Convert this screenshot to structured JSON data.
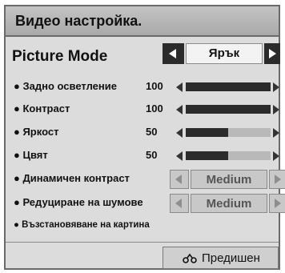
{
  "title": "Видео настройка.",
  "picture_mode": {
    "label": "Picture Mode",
    "value": "Ярък"
  },
  "sliders": [
    {
      "label": "Задно осветление",
      "value": "100",
      "level": 1.0
    },
    {
      "label": "Контраст",
      "value": "100",
      "level": 1.0
    },
    {
      "label": "Яркост",
      "value": "50",
      "level": 0.5
    },
    {
      "label": "Цвят",
      "value": "50",
      "level": 0.5
    }
  ],
  "selectors": [
    {
      "label": "Динамичен контраст",
      "value": "Medium"
    },
    {
      "label": "Редуциране на шумове",
      "value": "Medium"
    }
  ],
  "reset_label": "Възстановяване на картина",
  "back_button": {
    "label": "Предишен",
    "icon": "back-arrow-icon"
  },
  "colors": {
    "dark": "#2b2b2b",
    "panel": "#dcdcdc",
    "header": "#b0b0b0"
  }
}
